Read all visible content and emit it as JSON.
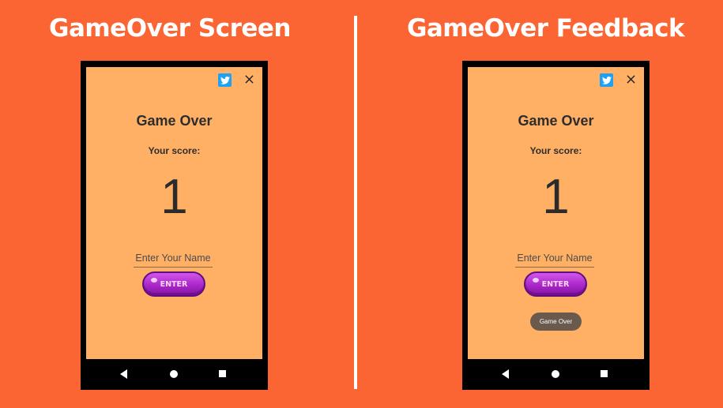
{
  "headings": {
    "left": "GameOver Screen",
    "right": "GameOver Feedback"
  },
  "screens": [
    {
      "title": "Game Over",
      "score_label": "Your score:",
      "score": "1",
      "name_placeholder": "Enter Your Name",
      "enter_label": "ENTER"
    },
    {
      "title": "Game Over",
      "score_label": "Your score:",
      "score": "1",
      "name_placeholder": "Enter Your Name",
      "enter_label": "ENTER",
      "toast": "Game Over"
    }
  ],
  "icons": {
    "share": "twitter-icon",
    "close": "close-icon",
    "back": "nav-back-icon",
    "home": "nav-home-icon",
    "recents": "nav-recents-icon"
  },
  "colors": {
    "background": "#fb6534",
    "screen": "#ffb065",
    "button": "#a927c7",
    "twitter": "#1ea1f3",
    "toast": "#6a5a4e"
  }
}
